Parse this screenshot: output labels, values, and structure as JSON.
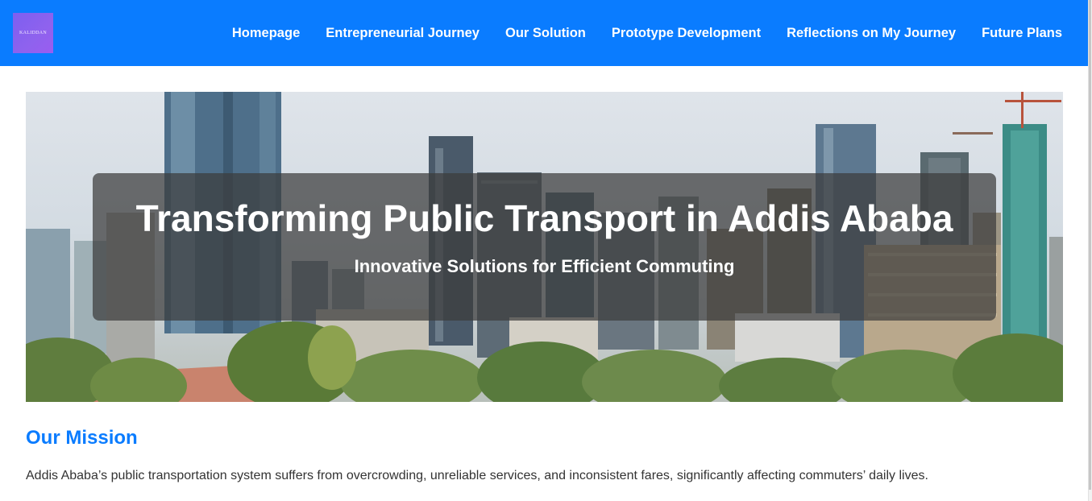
{
  "brand": {
    "logo_text": "KALIDDAN"
  },
  "nav": {
    "items": [
      {
        "label": "Homepage"
      },
      {
        "label": "Entrepreneurial Journey"
      },
      {
        "label": "Our Solution"
      },
      {
        "label": "Prototype Development"
      },
      {
        "label": "Reflections on My Journey"
      },
      {
        "label": "Future Plans"
      }
    ]
  },
  "hero": {
    "title": "Transforming Public Transport in Addis Ababa",
    "subtitle": "Innovative Solutions for Efficient Commuting",
    "image": "addis-ababa-city-skyline"
  },
  "mission": {
    "title": "Our Mission",
    "text": "Addis Ababa’s public transportation system suffers from overcrowding, unreliable services, and inconsistent fares, significantly affecting commuters’ daily lives."
  },
  "colors": {
    "primary": "#0a7cff",
    "logo": "#8a60ef",
    "overlay": "#3c3c3c",
    "text": "#333333"
  }
}
